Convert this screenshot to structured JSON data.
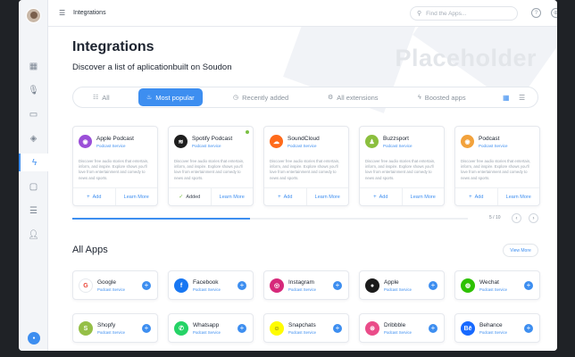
{
  "topbar": {
    "title": "Integrations",
    "search_placeholder": "Find the Apps...",
    "help_icon": "?",
    "globe_icon": "⊕"
  },
  "sidebar": {
    "items": [
      "dashboard-icon",
      "microphone-icon",
      "inbox-icon",
      "layers-icon",
      "bolt-icon",
      "chat-icon",
      "list-icon",
      "user-icon"
    ],
    "active": "bolt-icon",
    "badge": "Logo"
  },
  "header": {
    "title": "Integrations",
    "subtitle": "Discover a list of aplicationbuilt on Soudon",
    "placeholder": "Placeholder"
  },
  "tabs": [
    {
      "label": "All",
      "icon": "☷"
    },
    {
      "label": "Most popular",
      "icon": "♨"
    },
    {
      "label": "Recently added",
      "icon": "◷"
    },
    {
      "label": "All extensions",
      "icon": "⚙"
    },
    {
      "label": "Boosted apps",
      "icon": "ϟ"
    }
  ],
  "cards": [
    {
      "name": "Apple Podcast",
      "service": "Podcast Service",
      "color": "#9b4fd8",
      "glyph": "◉",
      "desc": "Discover free audio stories that entertain, inform, and inspire. Explore shows you'll love from entertainment and comedy to news and sports.",
      "left": "Add",
      "left_icon": "+",
      "right": "Learn More",
      "added": false
    },
    {
      "name": "Spotify Podcast",
      "service": "Podcast Service",
      "color": "#1e1e1e",
      "glyph": "≋",
      "desc": "Discover free audio stories that entertain, inform, and inspire. Explore shows you'll love from entertainment and comedy to news and sports.",
      "left": "Added",
      "left_icon": "✓",
      "right": "Learn More",
      "added": true
    },
    {
      "name": "SoundCloud",
      "service": "Podcast Service",
      "color": "#ff6a1a",
      "glyph": "☁",
      "desc": "Discover free audio stories that entertain, inform, and inspire. Explore shows you'll love from entertainment and comedy to news and sports.",
      "left": "Add",
      "left_icon": "+",
      "right": "Learn More",
      "added": false
    },
    {
      "name": "Buzzsport",
      "service": "Podcast Service",
      "color": "#8bbf3e",
      "glyph": "♟",
      "desc": "Discover free audio stories that entertain, inform, and inspire. Explore shows you'll love from entertainment and comedy to news and sports.",
      "left": "Add",
      "left_icon": "+",
      "right": "Learn More",
      "added": false
    },
    {
      "name": "Podcast",
      "service": "Podcast Service",
      "color": "#f2a23c",
      "glyph": "◉",
      "desc": "Discover free audio stories that entertain, inform, and inspire. Explore shows you'll love from entertainment and comedy to news and sports.",
      "left": "Add",
      "left_icon": "+",
      "right": "Learn More",
      "added": false
    }
  ],
  "carousel": {
    "page": "5 / 10",
    "progress": 0.45
  },
  "all_apps": {
    "title": "All Apps",
    "view_more": "View More",
    "apps": [
      {
        "name": "Google",
        "service": "Podcast Service",
        "color": "#ffffff",
        "glyph": "G",
        "glyph_color": "#ea4335"
      },
      {
        "name": "Facebook",
        "service": "Podcast Service",
        "color": "#1877f2",
        "glyph": "f",
        "glyph_color": "#ffffff"
      },
      {
        "name": "Instagram",
        "service": "Podcast Service",
        "color": "#d6297a",
        "glyph": "◎",
        "glyph_color": "#ffffff"
      },
      {
        "name": "Apple",
        "service": "Podcast Service",
        "color": "#1b1b1b",
        "glyph": "●",
        "glyph_color": "#ffffff"
      },
      {
        "name": "Wechat",
        "service": "Podcast Service",
        "color": "#2dc100",
        "glyph": "◍",
        "glyph_color": "#ffffff"
      },
      {
        "name": "Shopfy",
        "service": "Podcast Service",
        "color": "#95bf47",
        "glyph": "S",
        "glyph_color": "#ffffff"
      },
      {
        "name": "Whatsapp",
        "service": "Podcast Service",
        "color": "#25d366",
        "glyph": "✆",
        "glyph_color": "#ffffff"
      },
      {
        "name": "Snapchats",
        "service": "Podcast Service",
        "color": "#fffc00",
        "glyph": "☺",
        "glyph_color": "#333333"
      },
      {
        "name": "Dribbble",
        "service": "Podcast Service",
        "color": "#ea4c89",
        "glyph": "⊛",
        "glyph_color": "#ffffff"
      },
      {
        "name": "Behance",
        "service": "Podcast Service",
        "color": "#1769ff",
        "glyph": "Bē",
        "glyph_color": "#ffffff"
      }
    ]
  },
  "colors": {
    "accent": "#3d8ef0",
    "success": "#7bc043"
  }
}
